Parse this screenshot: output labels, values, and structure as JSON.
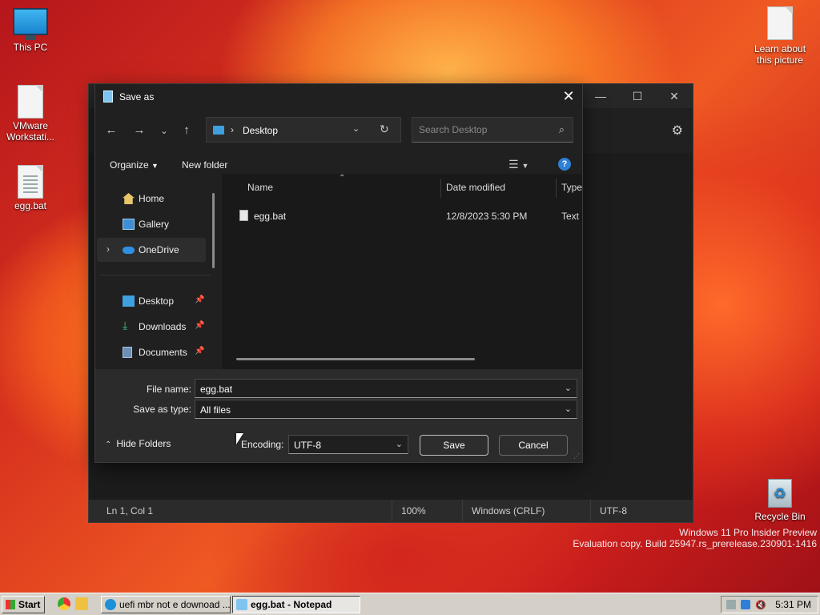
{
  "desktop": {
    "icons": [
      {
        "label": "This PC"
      },
      {
        "label": "VMware Workstati..."
      },
      {
        "label": "egg.bat"
      },
      {
        "label": "Learn about this picture"
      },
      {
        "label": "Recycle Bin"
      }
    ],
    "watermark_line1": "Windows 11 Pro Insider Preview",
    "watermark_line2": "Evaluation copy. Build 25947.rs_prerelease.230901-1416"
  },
  "notepad": {
    "status": {
      "position": "Ln 1, Col 1",
      "zoom": "100%",
      "line_ending": "Windows (CRLF)",
      "encoding": "UTF-8"
    }
  },
  "dialog": {
    "title": "Save as",
    "address": {
      "location": "Desktop"
    },
    "search": {
      "placeholder": "Search Desktop"
    },
    "toolbar": {
      "organize": "Organize",
      "new_folder": "New folder"
    },
    "nav": {
      "home": "Home",
      "gallery": "Gallery",
      "onedrive": "OneDrive",
      "desktop": "Desktop",
      "downloads": "Downloads",
      "documents": "Documents"
    },
    "columns": {
      "name": "Name",
      "date_modified": "Date modified",
      "type": "Type"
    },
    "files": [
      {
        "name": "egg.bat",
        "date_modified": "12/8/2023 5:30 PM",
        "type": "Text Document"
      }
    ],
    "file_name_label": "File name:",
    "file_name_value": "egg.bat",
    "save_type_label": "Save as type:",
    "save_type_value": "All files",
    "hide_folders": "Hide Folders",
    "encoding_label": "Encoding:",
    "encoding_value": "UTF-8",
    "save_button": "Save",
    "cancel_button": "Cancel"
  },
  "taskbar": {
    "start": "Start",
    "tasks": [
      {
        "label": "uefi mbr not e downoad ..."
      },
      {
        "label": "egg.bat - Notepad"
      }
    ],
    "clock": "5:31 PM"
  },
  "colors": {
    "dialog_bg": "#202020",
    "accent": "#2f7fd6",
    "taskbar": "#d4d0c8"
  }
}
